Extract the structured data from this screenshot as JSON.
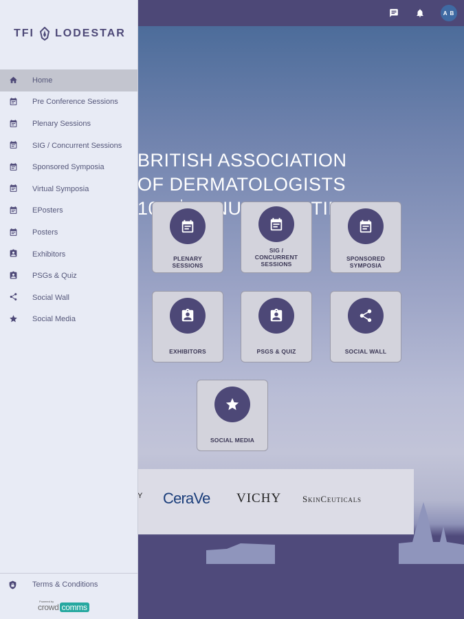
{
  "header": {
    "chat_icon": "chat-icon",
    "bell_icon": "bell-icon",
    "avatar_initials": "A B"
  },
  "headline": {
    "line1": "BRITISH ASSOCIATION",
    "line2": "OF DERMATOLOGISTS",
    "line3_prefix": "102",
    "line3_sup": "nd",
    "line3_suffix": " ANNUAL MEETING"
  },
  "tiles": [
    {
      "label": "PLENARY SESSIONS",
      "icon": "calendar-icon"
    },
    {
      "label": "SIG / CONCURRENT SESSIONS",
      "icon": "calendar-icon"
    },
    {
      "label": "SPONSORED SYMPOSIA",
      "icon": "calendar-icon"
    },
    {
      "label": "EXHIBITORS",
      "icon": "badge-icon"
    },
    {
      "label": "PSGS & QUIZ",
      "icon": "badge-icon"
    },
    {
      "label": "SOCIAL WALL",
      "icon": "share-icon"
    },
    {
      "label": "SOCIAL MEDIA",
      "icon": "star-icon"
    }
  ],
  "sponsors": [
    "Y",
    "CeraVe",
    "VICHY",
    "SkinCeuticals"
  ],
  "drawer": {
    "logo_left": "TFI",
    "logo_right": "LODESTAR",
    "items": [
      {
        "label": "Home",
        "icon": "home-icon",
        "active": true
      },
      {
        "label": "Pre Conference Sessions",
        "icon": "calendar-icon"
      },
      {
        "label": "Plenary Sessions",
        "icon": "calendar-icon"
      },
      {
        "label": "SIG / Concurrent Sessions",
        "icon": "calendar-icon"
      },
      {
        "label": "Sponsored Symposia",
        "icon": "calendar-icon"
      },
      {
        "label": "Virtual Symposia",
        "icon": "calendar-icon"
      },
      {
        "label": "EPosters",
        "icon": "calendar-icon"
      },
      {
        "label": "Posters",
        "icon": "calendar-icon"
      },
      {
        "label": "Exhibitors",
        "icon": "badge-icon"
      },
      {
        "label": "PSGs & Quiz",
        "icon": "badge-icon"
      },
      {
        "label": "Social Wall",
        "icon": "share-icon"
      },
      {
        "label": "Social Media",
        "icon": "star-icon"
      }
    ],
    "terms_label": "Terms & Conditions",
    "powered_by": "Powered by",
    "powered_brand_a": "crowd",
    "powered_brand_b": "comms"
  },
  "colors": {
    "brand": "#4d4877",
    "drawer_bg": "#e8ebf5",
    "tile_bg": "#d3d3dc",
    "active_item": "#c3c5cf"
  }
}
